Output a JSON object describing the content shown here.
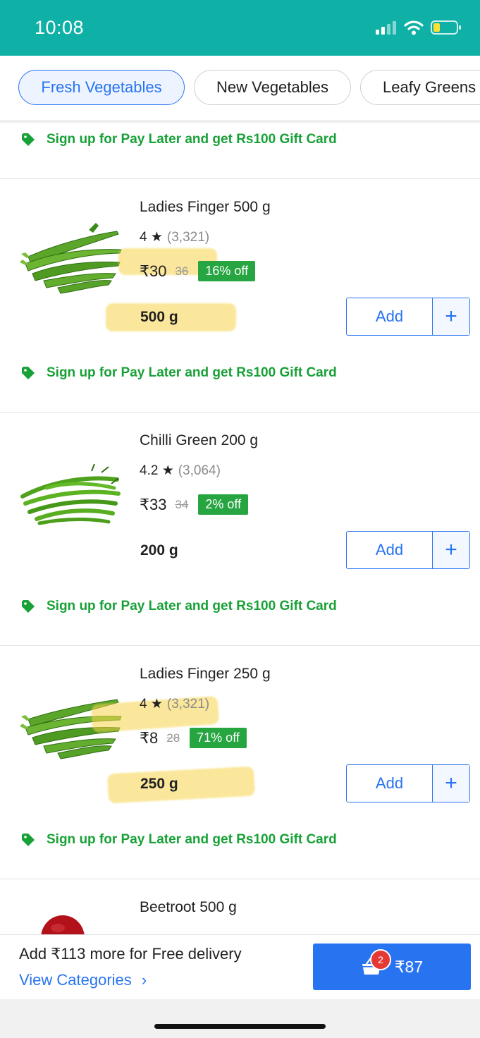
{
  "status_bar": {
    "time": "10:08"
  },
  "chips": [
    "Fresh Vegetables",
    "New Vegetables",
    "Leafy Greens"
  ],
  "promo_text": "Sign up for Pay Later and get Rs100 Gift Card",
  "products": [
    {
      "name": "Ladies Finger 500 g",
      "rating": "4 ★",
      "reviews": "(3,321)",
      "price": "₹30",
      "mrp": "36",
      "discount": "16% off",
      "quantity": "500 g",
      "add_label": "Add",
      "plus_label": "+"
    },
    {
      "name": "Chilli Green 200 g",
      "rating": "4.2 ★",
      "reviews": "(3,064)",
      "price": "₹33",
      "mrp": "34",
      "discount": "2% off",
      "quantity": "200 g",
      "add_label": "Add",
      "plus_label": "+"
    },
    {
      "name": "Ladies Finger 250 g",
      "rating": "4 ★",
      "reviews": "(3,321)",
      "price": "₹8",
      "mrp": "28",
      "discount": "71% off",
      "quantity": "250 g",
      "add_label": "Add",
      "plus_label": "+"
    },
    {
      "name": "Beetroot 500 g"
    }
  ],
  "bottom_bar": {
    "delivery_text": "Add ₹113 more for Free delivery",
    "view_categories": "View Categories",
    "chevron": "›",
    "cart_count": "2",
    "cart_total": "₹87"
  },
  "colors": {
    "status_bar": "#0fb1a6",
    "primary": "#2874f0",
    "promo_green": "#18a137",
    "discount_green": "#26a541",
    "highlight": "#f7d44a"
  },
  "icons": [
    "cellular-signal-icon",
    "wifi-icon",
    "battery-icon",
    "tag-icon",
    "basket-icon",
    "chevron-right-icon"
  ]
}
